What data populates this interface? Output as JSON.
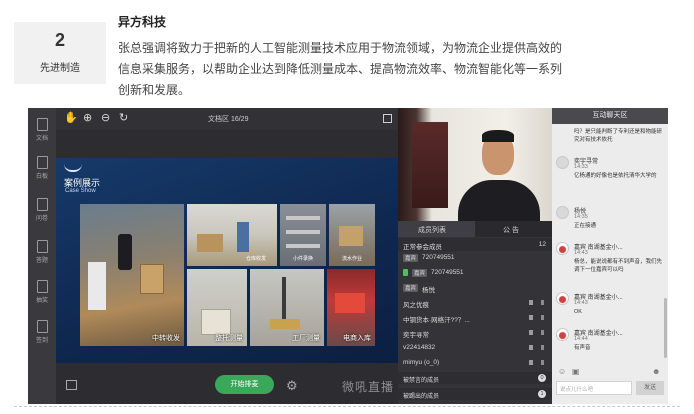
{
  "article": {
    "number": "2",
    "category": "先进制造",
    "company": "异方科技",
    "body": "张总强调将致力于把新的人工智能测量技术应用于物流领域，为物流企业提供高效的信息采集服务，以帮助企业达到降低测量成本、提高物流效率、物流智能化等一系列创新和发展。"
  },
  "app": {
    "left_tools": [
      {
        "label": "文档",
        "icon": "document-icon"
      },
      {
        "label": "白板",
        "icon": "whiteboard-icon"
      },
      {
        "label": "问卷",
        "icon": "questionnaire-icon"
      },
      {
        "label": "答题",
        "icon": "quiz-icon"
      },
      {
        "label": "抽奖",
        "icon": "gift-icon"
      },
      {
        "label": "签到",
        "icon": "checkin-icon"
      }
    ],
    "toolbar": {
      "doc_page": "文档区 16/29",
      "hand": "✋",
      "zoom_in": "⊕",
      "zoom_out": "⊖",
      "rotate": "↻"
    },
    "slide": {
      "title_cn": "案例展示",
      "title_en": "Case Show",
      "captions": {
        "logistics": "中转收发",
        "warehouse": "仓库收发",
        "small_warehouse": "小件录换",
        "pipeline": "流水作业",
        "pallet": "整托测量",
        "factory": "工厂测量",
        "ecommerce": "电商入库"
      }
    },
    "bottom": {
      "start_button": "开始排麦",
      "brand": "微吼直播"
    },
    "members": {
      "tab_members": "成员列表",
      "tab_notice": "公 告",
      "online_label": "正常参会成员",
      "online_count": "12",
      "rows": [
        {
          "name": "720749551",
          "tag": "嘉宾"
        },
        {
          "name": "720749551",
          "tag": "嘉宾"
        },
        {
          "name": "杨悦",
          "tag": "嘉宾"
        },
        {
          "name": "风之优痕",
          "tag": ""
        },
        {
          "name": "中钢货本·网络汗??？...",
          "tag": ""
        },
        {
          "name": "奕宇寻常",
          "tag": ""
        },
        {
          "name": "v22414832",
          "tag": ""
        },
        {
          "name": "mimyu (o_0)",
          "tag": ""
        }
      ],
      "muted_label": "被禁言的成员",
      "muted_count": "0",
      "kicked_label": "被踢出的成员",
      "kicked_count": "1"
    },
    "chat": {
      "title": "互动聊天区",
      "top_text": "吗？是只能判断了专利还是和物能研究对有技术依托",
      "messages": [
        {
          "name": "奕宇寻常",
          "time": "14:33",
          "text": "亿杨通的好像也是依托清华大学的"
        },
        {
          "name": "杨悦",
          "time": "14:35",
          "text": "正在接通"
        },
        {
          "name": "嘉宾 南湖基金小...",
          "time": "14:43",
          "text": "杨总，能说说都有不到声音，我们先调下一位嘉宾可以吗"
        },
        {
          "name": "嘉宾 南湖基金小...",
          "time": "14:43",
          "text": "OK"
        },
        {
          "name": "嘉宾 南湖基金小...",
          "time": "14:44",
          "text": "有声音"
        }
      ],
      "input_placeholder": "说点儿什么吧",
      "send": "发送"
    }
  }
}
